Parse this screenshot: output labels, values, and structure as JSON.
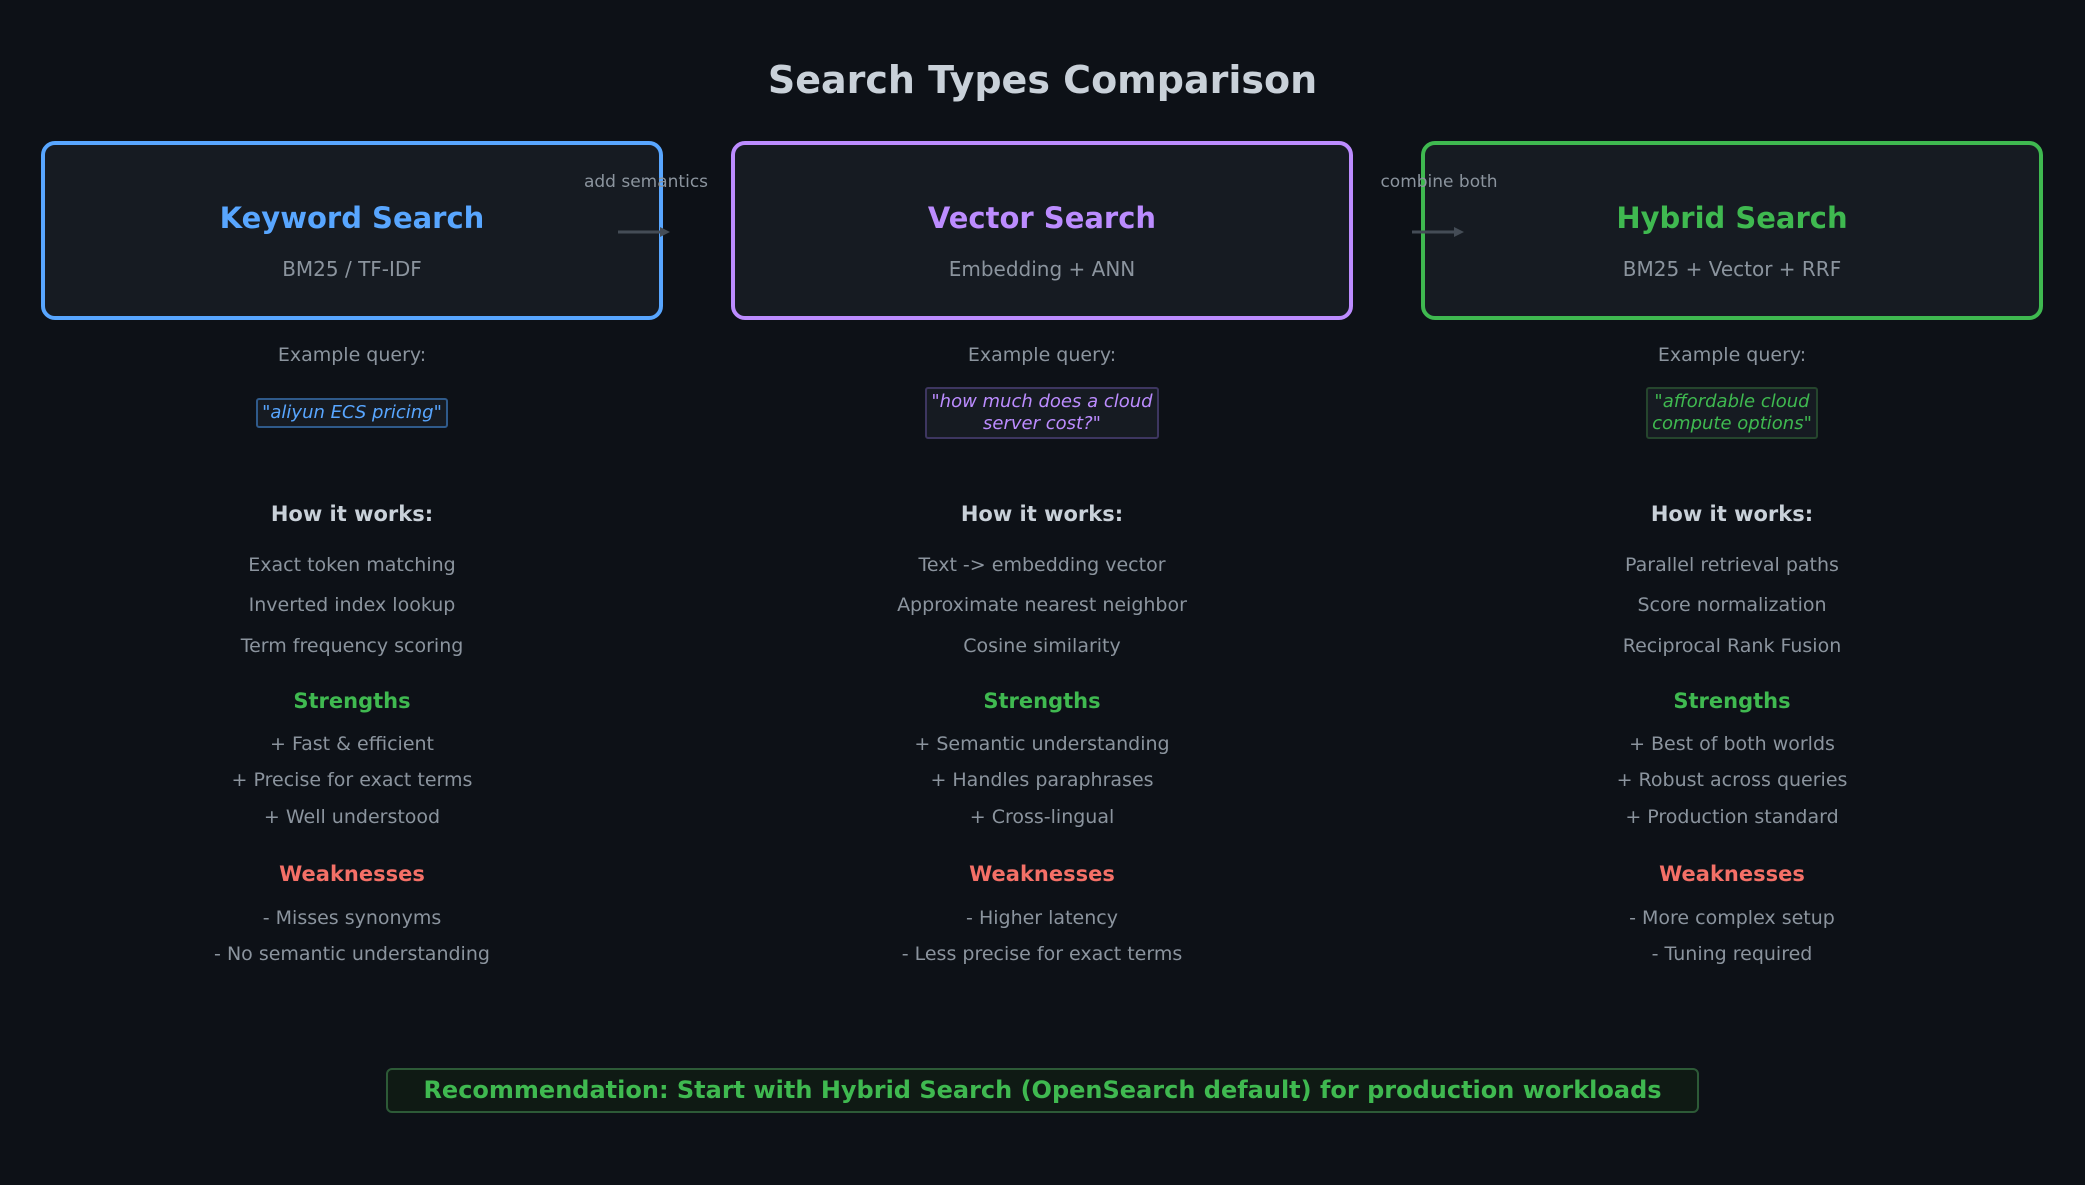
{
  "title": "Search Types Comparison",
  "colors": {
    "keyword": "#58a6ff",
    "vector": "#bc8cff",
    "hybrid": "#3fb950",
    "strengths": "#3fb950",
    "weaknesses": "#f47067"
  },
  "columns": [
    {
      "title": "Keyword Search",
      "subtitle": "BM25 / TF-IDF",
      "example_label": "Example query:",
      "query": "\"aliyun ECS pricing\"",
      "how_label": "How it works:",
      "how": [
        "Exact token matching",
        "Inverted index lookup",
        "Term frequency scoring"
      ],
      "strengths_label": "Strengths",
      "strengths": [
        "+ Fast & efficient",
        "+ Precise for exact terms",
        "+ Well understood"
      ],
      "weaknesses_label": "Weaknesses",
      "weaknesses": [
        "- Misses synonyms",
        "- No semantic understanding"
      ]
    },
    {
      "title": "Vector Search",
      "subtitle": "Embedding + ANN",
      "example_label": "Example query:",
      "query_line1": "\"how much does a cloud",
      "query_line2": "server cost?\"",
      "how_label": "How it works:",
      "how": [
        "Text -> embedding vector",
        "Approximate nearest neighbor",
        "Cosine similarity"
      ],
      "strengths_label": "Strengths",
      "strengths": [
        "+ Semantic understanding",
        "+ Handles paraphrases",
        "+ Cross-lingual"
      ],
      "weaknesses_label": "Weaknesses",
      "weaknesses": [
        "- Higher latency",
        "- Less precise for exact terms"
      ]
    },
    {
      "title": "Hybrid Search",
      "subtitle": "BM25 + Vector + RRF",
      "example_label": "Example query:",
      "query_line1": "\"affordable cloud",
      "query_line2": "compute options\"",
      "how_label": "How it works:",
      "how": [
        "Parallel retrieval paths",
        "Score normalization",
        "Reciprocal Rank Fusion"
      ],
      "strengths_label": "Strengths",
      "strengths": [
        "+ Best of both worlds",
        "+ Robust across queries",
        "+ Production standard"
      ],
      "weaknesses_label": "Weaknesses",
      "weaknesses": [
        "- More complex setup",
        "- Tuning required"
      ]
    }
  ],
  "arrows": [
    "add semantics",
    "combine both"
  ],
  "recommendation": "Recommendation: Start with Hybrid Search (OpenSearch default) for production workloads"
}
